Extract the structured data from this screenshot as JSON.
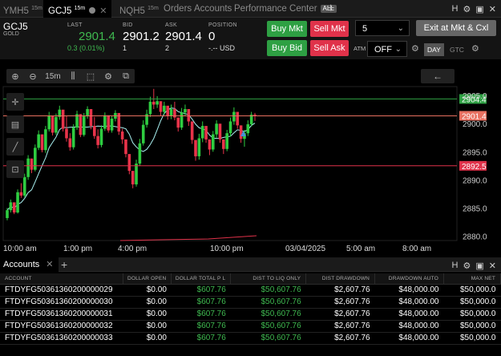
{
  "tabs": [
    {
      "label": "YMH5",
      "interval": "15m"
    },
    {
      "label": "GCJ5",
      "interval": "15m"
    },
    {
      "label": "NQH5",
      "interval": "15m"
    },
    {
      "label": "Orders"
    },
    {
      "label": "Accounts"
    },
    {
      "label": "Performance Center",
      "badge": "ALL"
    }
  ],
  "window_icons": {
    "help": "H",
    "settings": "⚙",
    "layout": "▣",
    "close": "✕"
  },
  "instrument": {
    "symbol": "GCJ5",
    "name": "GOLD"
  },
  "quote": {
    "last_label": "LAST",
    "last": "2901.4",
    "change": "0.3 (0.01%)",
    "bid_label": "BID",
    "bid": "2901.2",
    "bid_size": "1",
    "ask_label": "ASK",
    "ask": "2901.4",
    "ask_size": "2",
    "position_label": "POSITION",
    "position": "0",
    "position_pnl": "-.-- USD"
  },
  "order_buttons": {
    "buy_mkt": "Buy Mkt",
    "sell_mkt": "Sell Mkt",
    "buy_bid": "Buy Bid",
    "sell_ask": "Sell Ask",
    "exit": "Exit at Mkt & Cxl"
  },
  "quantity": "5",
  "atm": {
    "label": "ATM",
    "value": "OFF"
  },
  "tif": {
    "day": "DAY",
    "gtc": "GTC"
  },
  "toolbar": {
    "interval": "15m"
  },
  "chart_data": {
    "type": "candlestick",
    "price_labels": [
      "2905.0",
      "2900.0",
      "2895.0",
      "2890.0",
      "2885.0",
      "2880.0"
    ],
    "price_values": [
      2905,
      2900,
      2895,
      2890,
      2885,
      2880
    ],
    "ylim": [
      2879.2,
      2906.6
    ],
    "time_labels": [
      "10:00 am",
      "1:00 pm",
      "4:00 pm",
      "10:00 pm",
      "03/04/2025",
      "5:00 am",
      "8:00 am"
    ],
    "markers": [
      {
        "label": "2904.4",
        "value": 2904.4,
        "color": "#2ea043"
      },
      {
        "label": "2901.4",
        "value": 2901.4,
        "color": "#e87060"
      },
      {
        "label": "2892.5",
        "value": 2892.5,
        "color": "#e0324a"
      }
    ],
    "candles": [
      [
        2883.2,
        2885.0,
        2882.8,
        2884.6
      ],
      [
        2884.6,
        2886.5,
        2884.2,
        2886.0
      ],
      [
        2886.0,
        2885.6,
        2883.9,
        2884.2
      ],
      [
        2884.2,
        2888.3,
        2884.0,
        2887.8
      ],
      [
        2887.8,
        2889.4,
        2886.8,
        2887.2
      ],
      [
        2887.2,
        2891.1,
        2886.9,
        2890.5
      ],
      [
        2890.5,
        2894.4,
        2890.0,
        2893.8
      ],
      [
        2893.8,
        2893.1,
        2891.2,
        2891.8
      ],
      [
        2891.8,
        2896.3,
        2891.5,
        2895.7
      ],
      [
        2895.7,
        2898.8,
        2895.3,
        2898.1
      ],
      [
        2898.1,
        2897.0,
        2894.9,
        2895.3
      ],
      [
        2895.3,
        2899.6,
        2894.8,
        2899.0
      ],
      [
        2899.0,
        2902.1,
        2898.6,
        2901.4
      ],
      [
        2901.4,
        2900.5,
        2897.9,
        2898.4
      ],
      [
        2898.4,
        2901.8,
        2898.0,
        2901.2
      ],
      [
        2901.2,
        2903.2,
        2900.7,
        2902.5
      ],
      [
        2902.5,
        2901.8,
        2898.6,
        2899.1
      ],
      [
        2899.1,
        2901.4,
        2896.8,
        2897.4
      ],
      [
        2897.4,
        2898.3,
        2895.2,
        2895.8
      ],
      [
        2895.8,
        2899.9,
        2895.4,
        2899.3
      ],
      [
        2899.3,
        2902.3,
        2898.9,
        2901.7
      ],
      [
        2901.7,
        2901.5,
        2897.6,
        2898.0
      ],
      [
        2898.0,
        2901.9,
        2897.7,
        2901.3
      ],
      [
        2901.3,
        2903.1,
        2900.9,
        2902.6
      ],
      [
        2902.6,
        2902.0,
        2899.0,
        2899.6
      ],
      [
        2899.6,
        2901.2,
        2897.3,
        2897.8
      ],
      [
        2897.8,
        2899.0,
        2895.6,
        2896.2
      ],
      [
        2896.2,
        2899.7,
        2895.8,
        2899.1
      ],
      [
        2899.1,
        2902.0,
        2898.7,
        2901.5
      ],
      [
        2901.5,
        2901.3,
        2898.4,
        2898.8
      ],
      [
        2898.8,
        2901.4,
        2898.4,
        2900.9
      ],
      [
        2900.9,
        2902.4,
        2900.4,
        2901.9
      ],
      [
        2901.9,
        2900.9,
        2898.0,
        2898.6
      ],
      [
        2898.6,
        2899.1,
        2896.4,
        2897.2
      ],
      [
        2897.2,
        2896.6,
        2894.0,
        2894.6
      ],
      [
        2894.6,
        2893.9,
        2891.0,
        2891.6
      ],
      [
        2891.6,
        2891.0,
        2888.5,
        2889.2
      ],
      [
        2889.2,
        2893.6,
        2888.8,
        2892.9
      ],
      [
        2892.9,
        2897.3,
        2892.5,
        2896.5
      ],
      [
        2896.5,
        2900.6,
        2896.1,
        2899.8
      ],
      [
        2899.8,
        2902.5,
        2899.3,
        2901.7
      ],
      [
        2901.7,
        2904.8,
        2901.2,
        2903.9
      ],
      [
        2903.9,
        2906.2,
        2902.6,
        2903.4
      ],
      [
        2903.4,
        2904.9,
        2902.8,
        2904.0
      ],
      [
        2904.0,
        2903.6,
        2901.4,
        2902.1
      ],
      [
        2902.1,
        2903.9,
        2901.6,
        2903.2
      ],
      [
        2903.2,
        2902.7,
        2900.7,
        2901.4
      ],
      [
        2901.4,
        2903.4,
        2900.8,
        2902.6
      ],
      [
        2902.6,
        2903.9,
        2900.6,
        2901.1
      ],
      [
        2901.1,
        2900.8,
        2898.6,
        2899.3
      ],
      [
        2899.3,
        2902.8,
        2898.9,
        2902.0
      ],
      [
        2902.0,
        2903.4,
        2901.3,
        2902.6
      ],
      [
        2902.6,
        2902.1,
        2899.6,
        2900.4
      ],
      [
        2900.4,
        2899.6,
        2896.4,
        2897.1
      ],
      [
        2897.1,
        2896.5,
        2893.4,
        2894.2
      ],
      [
        2894.2,
        2898.2,
        2893.6,
        2897.4
      ],
      [
        2897.4,
        2900.4,
        2896.7,
        2899.6
      ],
      [
        2899.6,
        2899.2,
        2896.6,
        2897.2
      ],
      [
        2897.2,
        2896.8,
        2894.4,
        2895.4
      ],
      [
        2895.4,
        2898.7,
        2895.0,
        2898.1
      ],
      [
        2898.1,
        2900.6,
        2897.5,
        2900.0
      ],
      [
        2900.0,
        2899.6,
        2896.6,
        2897.2
      ],
      [
        2897.2,
        2896.6,
        2894.6,
        2895.5
      ],
      [
        2895.5,
        2898.9,
        2895.1,
        2898.3
      ],
      [
        2898.3,
        2901.1,
        2897.7,
        2900.4
      ],
      [
        2900.4,
        2902.9,
        2899.8,
        2902.1
      ],
      [
        2902.1,
        2901.6,
        2899.1,
        2899.7
      ],
      [
        2899.7,
        2899.1,
        2896.6,
        2897.3
      ],
      [
        2897.3,
        2898.9,
        2895.9,
        2898.3
      ],
      [
        2898.3,
        2900.6,
        2897.8,
        2899.9
      ],
      [
        2899.9,
        2902.1,
        2899.5,
        2901.6
      ],
      [
        2901.6,
        2901.9,
        2900.5,
        2901.4
      ]
    ]
  },
  "accounts_panel": {
    "title": "Accounts",
    "columns": [
      "ACCOUNT",
      "DOLLAR OPEN",
      "DOLLAR TOTAL P L",
      "DIST TO LIQ ONLY",
      "DIST DRAWDOWN",
      "DRAWDOWN AUTO",
      "MAX NET"
    ],
    "rows": [
      {
        "account": "FTDYFG50361360200000029",
        "dollar_open": "$0.00",
        "total_pl": "$607.76",
        "dist_liq": "$50,607.76",
        "dist_drawdown": "$2,607.76",
        "drawdown_auto": "$48,000.00",
        "max_net": "$50,000.0"
      },
      {
        "account": "FTDYFG50361360200000030",
        "dollar_open": "$0.00",
        "total_pl": "$607.76",
        "dist_liq": "$50,607.76",
        "dist_drawdown": "$2,607.76",
        "drawdown_auto": "$48,000.00",
        "max_net": "$50,000.0"
      },
      {
        "account": "FTDYFG50361360200000031",
        "dollar_open": "$0.00",
        "total_pl": "$607.76",
        "dist_liq": "$50,607.76",
        "dist_drawdown": "$2,607.76",
        "drawdown_auto": "$48,000.00",
        "max_net": "$50,000.0"
      },
      {
        "account": "FTDYFG50361360200000032",
        "dollar_open": "$0.00",
        "total_pl": "$607.76",
        "dist_liq": "$50,607.76",
        "dist_drawdown": "$2,607.76",
        "drawdown_auto": "$48,000.00",
        "max_net": "$50,000.0"
      },
      {
        "account": "FTDYFG50361360200000033",
        "dollar_open": "$0.00",
        "total_pl": "$607.76",
        "dist_liq": "$50,607.76",
        "dist_drawdown": "$2,607.76",
        "drawdown_auto": "$48,000.00",
        "max_net": "$50,000.0"
      }
    ]
  },
  "colors": {
    "up": "#2ecc40",
    "down": "#e8334a",
    "sma": "#a8f0f0",
    "accent_green": "#2ea043",
    "accent_red": "#e0324a"
  }
}
